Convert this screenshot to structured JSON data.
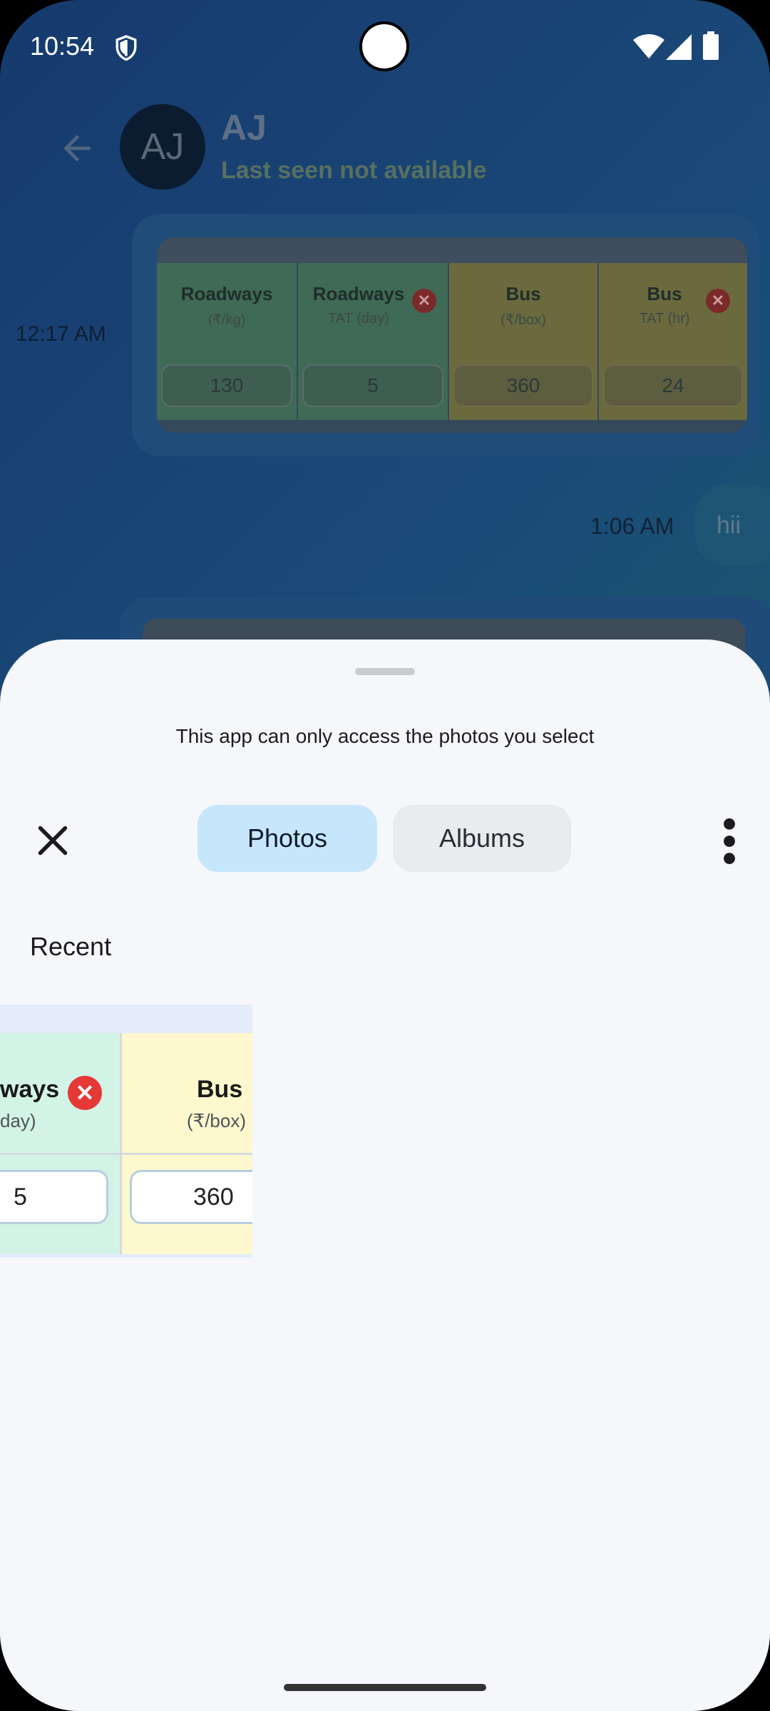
{
  "status_bar": {
    "time": "10:54"
  },
  "chat": {
    "avatar_initials": "AJ",
    "name": "AJ",
    "status": "Last seen not available",
    "message1_time": "12:17 AM",
    "table": {
      "columns": [
        {
          "title": "Roadways",
          "sub": "(₹/kg)",
          "value": "130"
        },
        {
          "title": "Roadways",
          "sub": "TAT (day)",
          "value": "5"
        },
        {
          "title": "Bus",
          "sub": "(₹/box)",
          "value": "360"
        },
        {
          "title": "Bus",
          "sub": "TAT (hr)",
          "value": "24"
        }
      ]
    },
    "message2_time": "1:06 AM",
    "message2_text": "hii"
  },
  "picker": {
    "notice": "This app can only access the photos you select",
    "tabs": {
      "photos": "Photos",
      "albums": "Albums"
    },
    "section_title": "Recent",
    "thumbnail": {
      "col1_title": "ways",
      "col1_sub": "day)",
      "col2_title": "Bus",
      "col2_sub": "(₹/box)",
      "val1": "5",
      "val2": "360"
    }
  },
  "colors": {
    "accent_tab": "#c6e6fb",
    "sheet_bg": "#f6f7fb"
  },
  "icons": [
    "shield-icon",
    "wifi-icon",
    "signal-icon",
    "battery-icon",
    "back-arrow-icon",
    "close-icon",
    "more-vert-icon"
  ]
}
